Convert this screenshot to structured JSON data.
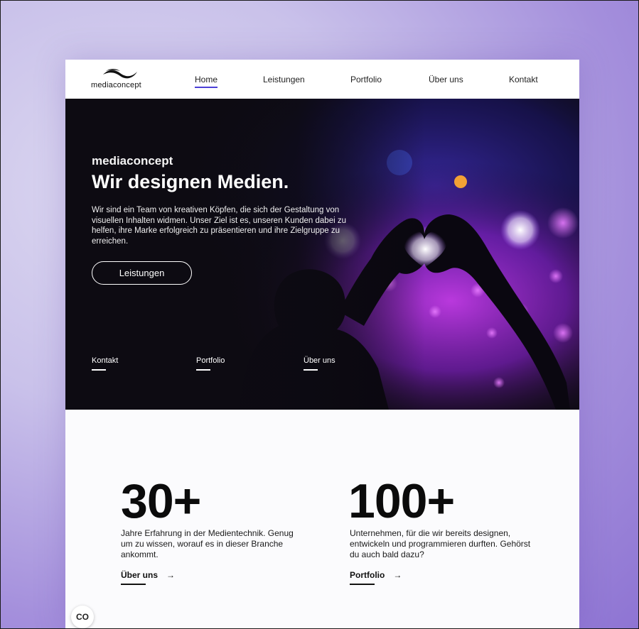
{
  "nav": {
    "logo_text": "mediaconcept",
    "items": [
      {
        "label": "Home",
        "active": true
      },
      {
        "label": "Leistungen",
        "active": false
      },
      {
        "label": "Portfolio",
        "active": false
      },
      {
        "label": "Über uns",
        "active": false
      },
      {
        "label": "Kontakt",
        "active": false
      }
    ]
  },
  "hero": {
    "subtitle": "mediaconcept",
    "title": "Wir designen Medien.",
    "text": "Wir sind ein Team von kreativen Köpfen, die sich der Gestaltung von visuellen Inhalten widmen. Unser Ziel ist es, unseren Kunden dabei zu helfen, ihre Marke erfolgreich zu präsentieren und ihre Zielgruppe zu erreichen.",
    "button_label": "Leistungen",
    "links": [
      "Kontakt",
      "Portfolio",
      "Über uns"
    ]
  },
  "stats": [
    {
      "number": "30+",
      "text": "Jahre Erfahrung in der Medientechnik. Genug um zu wissen, worauf es in dieser Branche ankommt.",
      "link_label": "Über uns",
      "link_arrow": "→"
    },
    {
      "number": "100+",
      "text": "Unternehmen, für die wir bereits designen, entwickeln und programmieren durften. Gehörst du auch bald dazu?",
      "link_label": "Portfolio",
      "link_arrow": "→"
    }
  ],
  "cookie_button": "CO",
  "colors": {
    "accent": "#4b3fd6",
    "hero_bg": "#0d0b12",
    "text": "#111111"
  }
}
